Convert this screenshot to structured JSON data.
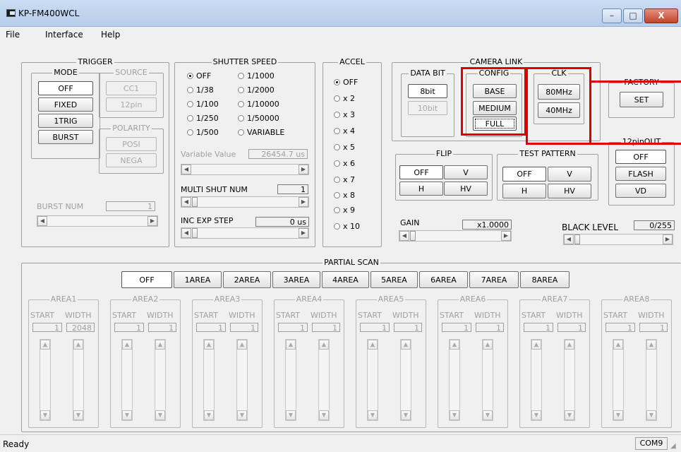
{
  "window": {
    "title": "KP-FM400WCL",
    "min": "–",
    "max": "□",
    "close": "X"
  },
  "menu": {
    "file": "File",
    "interface": "Interface",
    "help": "Help"
  },
  "trigger": {
    "label": "TRIGGER",
    "mode_label": "MODE",
    "modes": [
      "OFF",
      "FIXED",
      "1TRIG",
      "BURST"
    ],
    "source_label": "SOURCE",
    "sources": [
      "CC1",
      "12pin"
    ],
    "polarity_label": "POLARITY",
    "polarities": [
      "POSI",
      "NEGA"
    ],
    "burst_num_label": "BURST NUM",
    "burst_num_value": "1"
  },
  "shutter": {
    "label": "SHUTTER SPEED",
    "options": [
      "OFF",
      "1/38",
      "1/100",
      "1/250",
      "1/500",
      "1/1000",
      "1/2000",
      "1/10000",
      "1/50000",
      "VARIABLE"
    ],
    "selected": "OFF",
    "variable_label": "Variable Value",
    "variable_value": "26454.7 us",
    "multi_label": "MULTI SHUT NUM",
    "multi_value": "1",
    "inc_label": "INC EXP STEP",
    "inc_value": "0 us"
  },
  "accel": {
    "label": "ACCEL",
    "options": [
      "OFF",
      "x 2",
      "x 3",
      "x 4",
      "x 5",
      "x 6",
      "x 7",
      "x 8",
      "x 9",
      "x 10"
    ],
    "selected": "OFF"
  },
  "camlink": {
    "label": "CAMERA LINK",
    "databit_label": "DATA BIT",
    "databits": [
      "8bit",
      "10bit"
    ],
    "config_label": "CONFIG",
    "configs": [
      "BASE",
      "MEDIUM",
      "FULL"
    ],
    "clk_label": "CLK",
    "clks": [
      "80MHz",
      "40MHz"
    ]
  },
  "factory": {
    "label": "FACTORY",
    "set": "SET"
  },
  "pinout": {
    "label": "12pinOUT",
    "options": [
      "OFF",
      "FLASH",
      "VD"
    ]
  },
  "flip": {
    "label": "FLIP",
    "options": [
      "OFF",
      "V",
      "H",
      "HV"
    ]
  },
  "testpattern": {
    "label": "TEST PATTERN",
    "options": [
      "OFF",
      "V",
      "H",
      "HV"
    ]
  },
  "gain": {
    "label": "GAIN",
    "value": "x1.0000"
  },
  "black": {
    "label": "BLACK LEVEL",
    "value": "0/255"
  },
  "partial": {
    "label": "PARTIAL SCAN",
    "tabs": [
      "OFF",
      "1AREA",
      "2AREA",
      "3AREA",
      "4AREA",
      "5AREA",
      "6AREA",
      "7AREA",
      "8AREA"
    ],
    "areas": [
      {
        "name": "AREA1",
        "start": "1",
        "width": "2048"
      },
      {
        "name": "AREA2",
        "start": "1",
        "width": "1"
      },
      {
        "name": "AREA3",
        "start": "1",
        "width": "1"
      },
      {
        "name": "AREA4",
        "start": "1",
        "width": "1"
      },
      {
        "name": "AREA5",
        "start": "1",
        "width": "1"
      },
      {
        "name": "AREA6",
        "start": "1",
        "width": "1"
      },
      {
        "name": "AREA7",
        "start": "1",
        "width": "1"
      },
      {
        "name": "AREA8",
        "start": "1",
        "width": "1"
      }
    ],
    "start_label": "START",
    "width_label": "WIDTH"
  },
  "status": {
    "text": "Ready",
    "port": "COM9"
  },
  "colors": {
    "highlight": "#e00000"
  }
}
